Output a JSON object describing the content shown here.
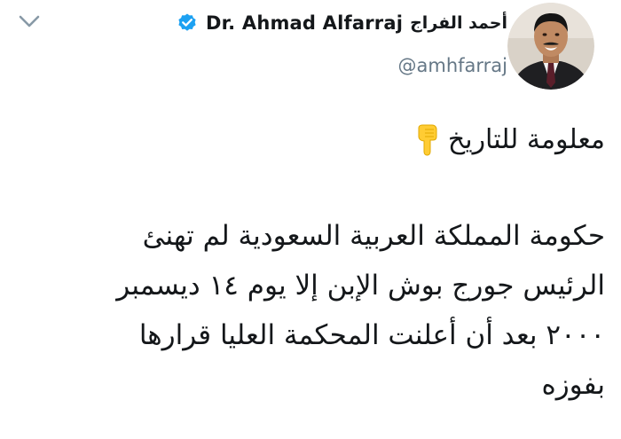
{
  "tweet": {
    "display_name": "Dr. Ahmad Alfarraj",
    "arabic_name": "أحمد الفراج",
    "handle": "@amhfarraj",
    "verified": true,
    "menu_icon": "chevron-down-icon",
    "heading": "معلومة للتاريخ",
    "heading_emoji": "pointing-down-hand-icon",
    "body_lines": [
      "حكومة المملكة العربية السعودية لم تهنئ",
      "الرئيس جورج بوش الإبن إلا يوم ١٤ ديسمبر",
      "٢٠٠٠ بعد أن أعلنت المحكمة العليا قرارها",
      "بفوزه"
    ]
  },
  "colors": {
    "verified_blue": "#1da1f2",
    "handle_gray": "#657786",
    "text": "#14171a",
    "chevron_gray": "#8899a6",
    "emoji_yellow": "#ffcc33"
  }
}
